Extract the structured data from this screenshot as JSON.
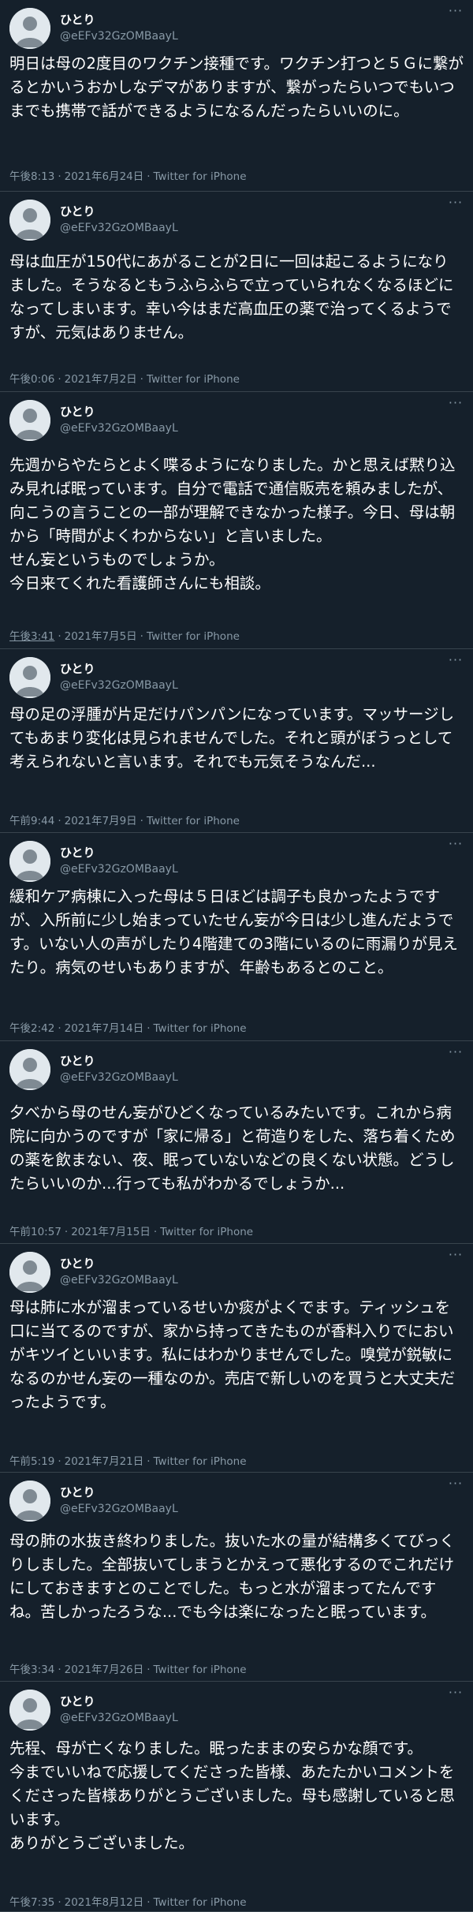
{
  "user": {
    "name": "ひとり",
    "handle": "@eEFv32GzOMBaayL"
  },
  "more_label": "···",
  "separator": "·",
  "tweets": [
    {
      "text": "明日は母の2度目のワクチン接種です。ワクチン打つと５Ｇに繋がるとかいうおかしなデマがありますが、繋がったらいつでもいつまでも携帯で話ができるようになるんだったらいいのに。",
      "time": "午後8:13",
      "date": "2021年6月24日",
      "source": "Twitter for iPhone"
    },
    {
      "text": "母は血圧が150代にあがることが2日に一回は起こるようになりました。そうなるともうふらふらで立っていられなくなるほどになってしまいます。幸い今はまだ高血圧の薬で治ってくるようですが、元気はありません。",
      "time": "午後0:06",
      "date": "2021年7月2日",
      "source": "Twitter for iPhone"
    },
    {
      "text": "先週からやたらとよく喋るようになりました。かと思えば黙り込み見れば眠っています。自分で電話で通信販売を頼みましたが、向こうの言うことの一部が理解できなかった様子。今日、母は朝から「時間がよくわからない」と言いました。\nせん妄というものでしょうか。\n今日来てくれた看護師さんにも相談。",
      "time": "午後3:41",
      "date": "2021年7月5日",
      "source": "Twitter for iPhone"
    },
    {
      "text": "母の足の浮腫が片足だけパンパンになっています。マッサージしてもあまり変化は見られませんでした。それと頭がぼうっとして考えられないと言います。それでも元気そうなんだ...",
      "time": "午前9:44",
      "date": "2021年7月9日",
      "source": "Twitter for iPhone"
    },
    {
      "text": "緩和ケア病棟に入った母は５日ほどは調子も良かったようですが、入所前に少し始まっていたせん妄が今日は少し進んだようです。いない人の声がしたり4階建ての3階にいるのに雨漏りが見えたり。病気のせいもありますが、年齢もあるとのこと。",
      "time": "午後2:42",
      "date": "2021年7月14日",
      "source": "Twitter for iPhone"
    },
    {
      "text": "夕べから母のせん妄がひどくなっているみたいです。これから病院に向かうのですが「家に帰る」と荷造りをした、落ち着くための薬を飲まない、夜、眠っていないなどの良くない状態。どうしたらいいのか...行っても私がわかるでしょうか...",
      "time": "午前10:57",
      "date": "2021年7月15日",
      "source": "Twitter for iPhone"
    },
    {
      "text": "母は肺に水が溜まっているせいか痰がよくでます。ティッシュを口に当てるのですが、家から持ってきたものが香料入りでにおいがキツイといいます。私にはわかりませんでした。嗅覚が鋭敏になるのかせん妄の一種なのか。売店で新しいのを買うと大丈夫だったようです。",
      "time": "午前5:19",
      "date": "2021年7月21日",
      "source": "Twitter for iPhone"
    },
    {
      "text": "母の肺の水抜き終わりました。抜いた水の量が結構多くてびっくりしました。全部抜いてしまうとかえって悪化するのでこれだけにしておきますとのことでした。もっと水が溜まってたんですね。苦しかったろうな...でも今は楽になったと眠っています。",
      "time": "午後3:34",
      "date": "2021年7月26日",
      "source": "Twitter for iPhone"
    },
    {
      "text": "先程、母が亡くなりました。眠ったままの安らかな顔です。\n今までいいねで応援してくださった皆様、あたたかいコメントをくださった皆様ありがとうございました。母も感謝していると思います。\nありがとうございました。",
      "time": "午後7:35",
      "date": "2021年8月12日",
      "source": "Twitter for iPhone"
    }
  ]
}
